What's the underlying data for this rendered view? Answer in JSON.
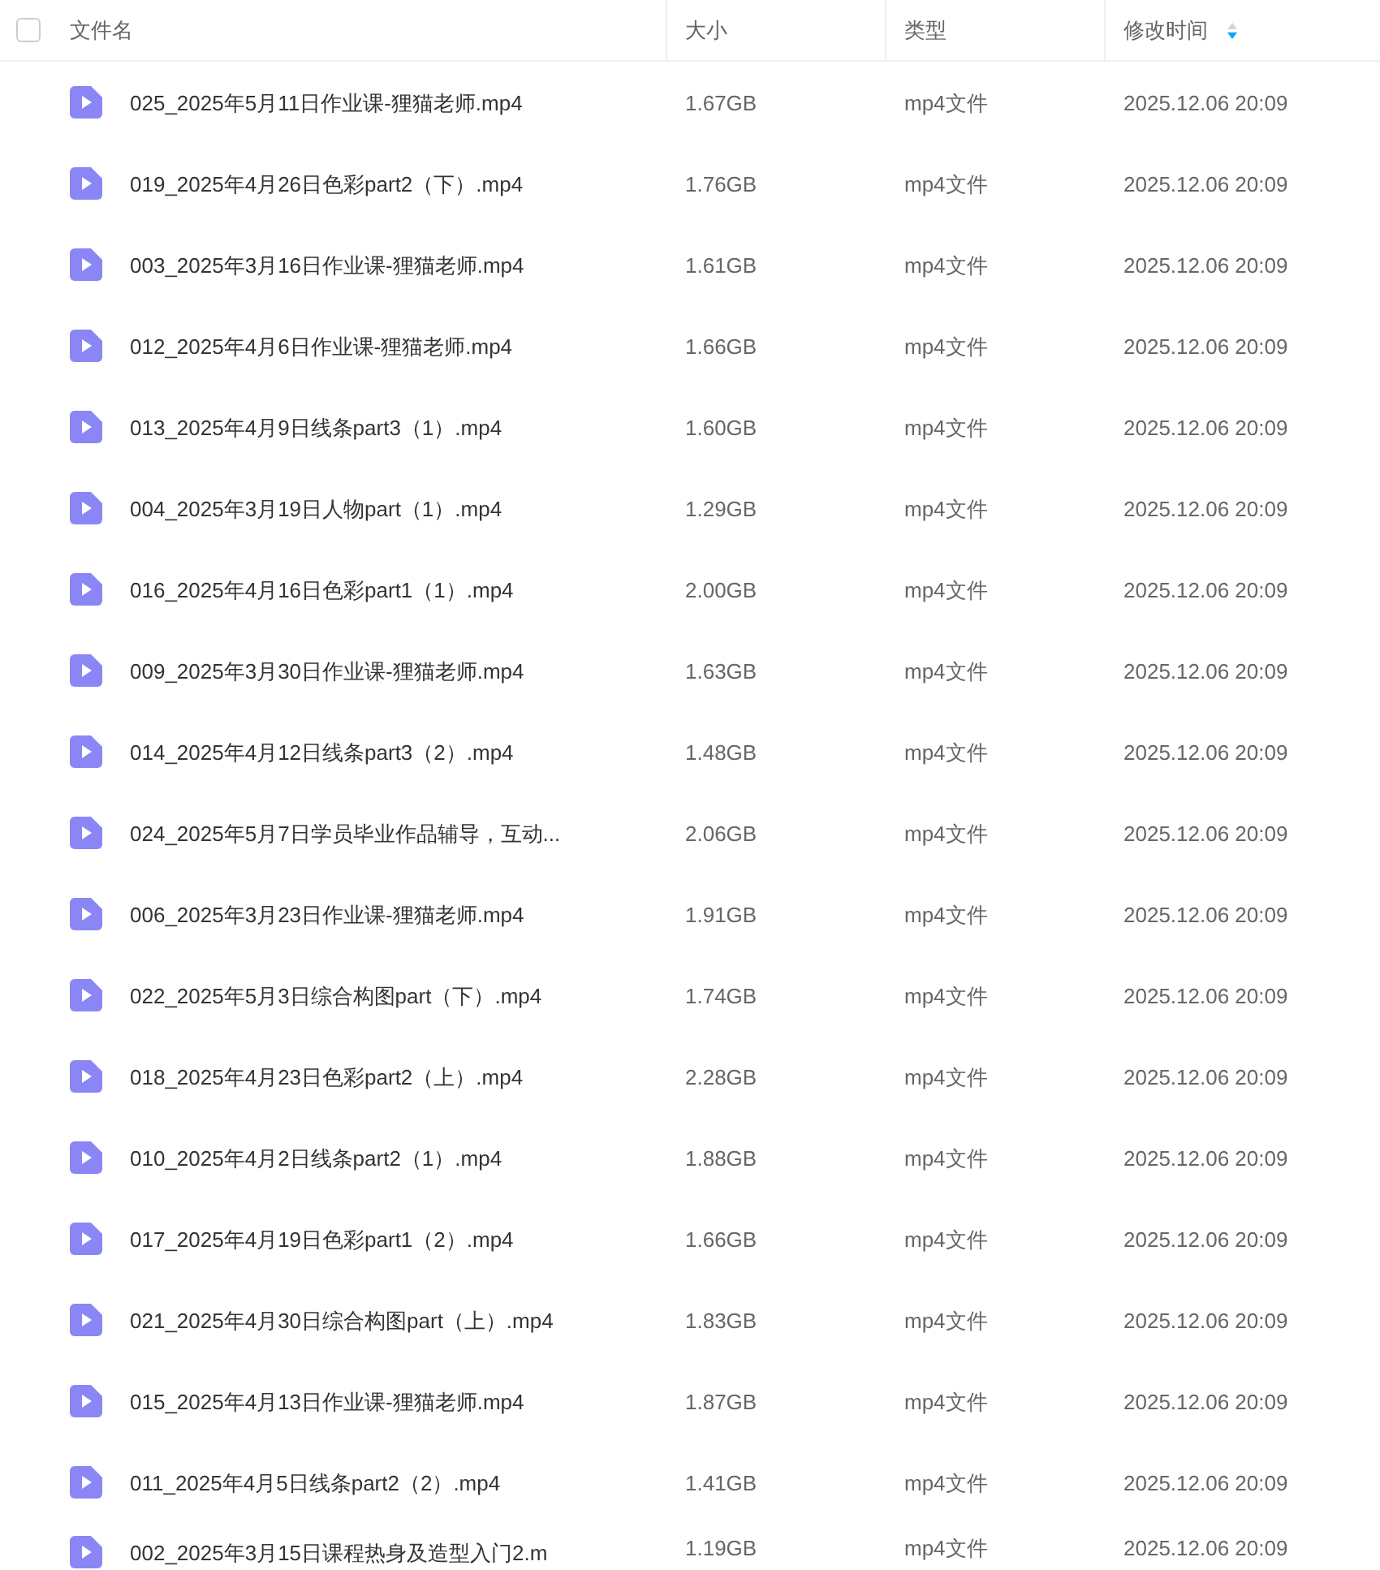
{
  "header": {
    "select_all_checked": false,
    "columns": [
      {
        "label": "文件名",
        "sorted": false
      },
      {
        "label": "大小",
        "sorted": false
      },
      {
        "label": "类型",
        "sorted": false
      },
      {
        "label": "修改时间",
        "sorted": true
      }
    ]
  },
  "rows": [
    {
      "name": "025_2025年5月11日作业课-狸猫老师.mp4",
      "size": "1.67GB",
      "type": "mp4文件",
      "modified": "2025.12.06 20:09"
    },
    {
      "name": "019_2025年4月26日色彩part2（下）.mp4",
      "size": "1.76GB",
      "type": "mp4文件",
      "modified": "2025.12.06 20:09"
    },
    {
      "name": "003_2025年3月16日作业课-狸猫老师.mp4",
      "size": "1.61GB",
      "type": "mp4文件",
      "modified": "2025.12.06 20:09"
    },
    {
      "name": "012_2025年4月6日作业课-狸猫老师.mp4",
      "size": "1.66GB",
      "type": "mp4文件",
      "modified": "2025.12.06 20:09"
    },
    {
      "name": "013_2025年4月9日线条part3（1）.mp4",
      "size": "1.60GB",
      "type": "mp4文件",
      "modified": "2025.12.06 20:09"
    },
    {
      "name": "004_2025年3月19日人物part（1）.mp4",
      "size": "1.29GB",
      "type": "mp4文件",
      "modified": "2025.12.06 20:09"
    },
    {
      "name": "016_2025年4月16日色彩part1（1）.mp4",
      "size": "2.00GB",
      "type": "mp4文件",
      "modified": "2025.12.06 20:09"
    },
    {
      "name": "009_2025年3月30日作业课-狸猫老师.mp4",
      "size": "1.63GB",
      "type": "mp4文件",
      "modified": "2025.12.06 20:09"
    },
    {
      "name": "014_2025年4月12日线条part3（2）.mp4",
      "size": "1.48GB",
      "type": "mp4文件",
      "modified": "2025.12.06 20:09"
    },
    {
      "name": "024_2025年5月7日学员毕业作品辅导，互动...",
      "size": "2.06GB",
      "type": "mp4文件",
      "modified": "2025.12.06 20:09"
    },
    {
      "name": "006_2025年3月23日作业课-狸猫老师.mp4",
      "size": "1.91GB",
      "type": "mp4文件",
      "modified": "2025.12.06 20:09"
    },
    {
      "name": "022_2025年5月3日综合构图part（下）.mp4",
      "size": "1.74GB",
      "type": "mp4文件",
      "modified": "2025.12.06 20:09"
    },
    {
      "name": "018_2025年4月23日色彩part2（上）.mp4",
      "size": "2.28GB",
      "type": "mp4文件",
      "modified": "2025.12.06 20:09"
    },
    {
      "name": "010_2025年4月2日线条part2（1）.mp4",
      "size": "1.88GB",
      "type": "mp4文件",
      "modified": "2025.12.06 20:09"
    },
    {
      "name": "017_2025年4月19日色彩part1（2）.mp4",
      "size": "1.66GB",
      "type": "mp4文件",
      "modified": "2025.12.06 20:09"
    },
    {
      "name": "021_2025年4月30日综合构图part（上）.mp4",
      "size": "1.83GB",
      "type": "mp4文件",
      "modified": "2025.12.06 20:09"
    },
    {
      "name": "015_2025年4月13日作业课-狸猫老师.mp4",
      "size": "1.87GB",
      "type": "mp4文件",
      "modified": "2025.12.06 20:09"
    },
    {
      "name": "011_2025年4月5日线条part2（2）.mp4",
      "size": "1.41GB",
      "type": "mp4文件",
      "modified": "2025.12.06 20:09"
    },
    {
      "name": "002_2025年3月15日课程热身及造型入门2.m",
      "size": "1.19GB",
      "type": "mp4文件",
      "modified": "2025.12.06 20:09"
    }
  ]
}
